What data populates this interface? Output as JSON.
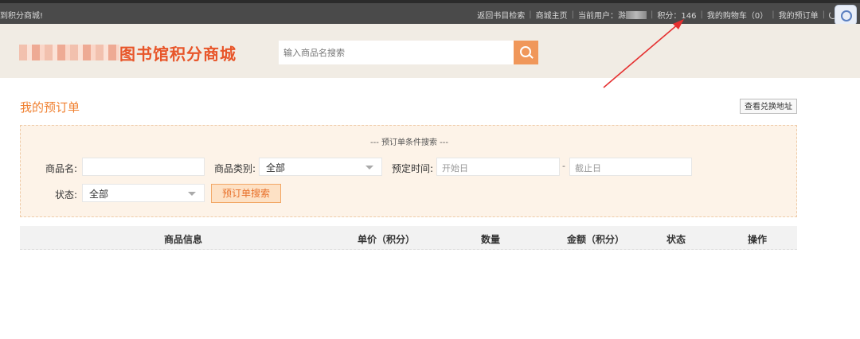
{
  "topbar": {
    "welcome": "到积分商城!",
    "links": {
      "catalog": "返回书目检索",
      "home": "商城主页",
      "current_user_label": "当前用户：",
      "user_initial": "滁",
      "points_label": "积分：146",
      "cart": "我的购物车（0）",
      "orders": "我的预订单",
      "logout": "退"
    }
  },
  "header": {
    "logo_text": "图书馆积分商城",
    "search_placeholder": "输入商品名搜索"
  },
  "page": {
    "title": "我的预订单",
    "address_button": "查看兑换地址"
  },
  "filter": {
    "title": "--- 预订单条件搜索 ---",
    "name_label": "商品名:",
    "category_label": "商品类别:",
    "category_value": "全部",
    "time_label": "预定时间:",
    "start_placeholder": "开始日",
    "end_placeholder": "截止日",
    "time_sep": "-",
    "status_label": "状态:",
    "status_value": "全部",
    "search_button": "预订单搜索"
  },
  "table": {
    "headers": [
      "商品信息",
      "单价（积分）",
      "数量",
      "金额（积分）",
      "状态",
      "操作"
    ]
  },
  "colors": {
    "accent": "#f08030",
    "logo": "#e8562a",
    "panel_bg": "#fdf3e8",
    "topbar_bg": "#4a4a4a",
    "arrow": "#e53030"
  }
}
